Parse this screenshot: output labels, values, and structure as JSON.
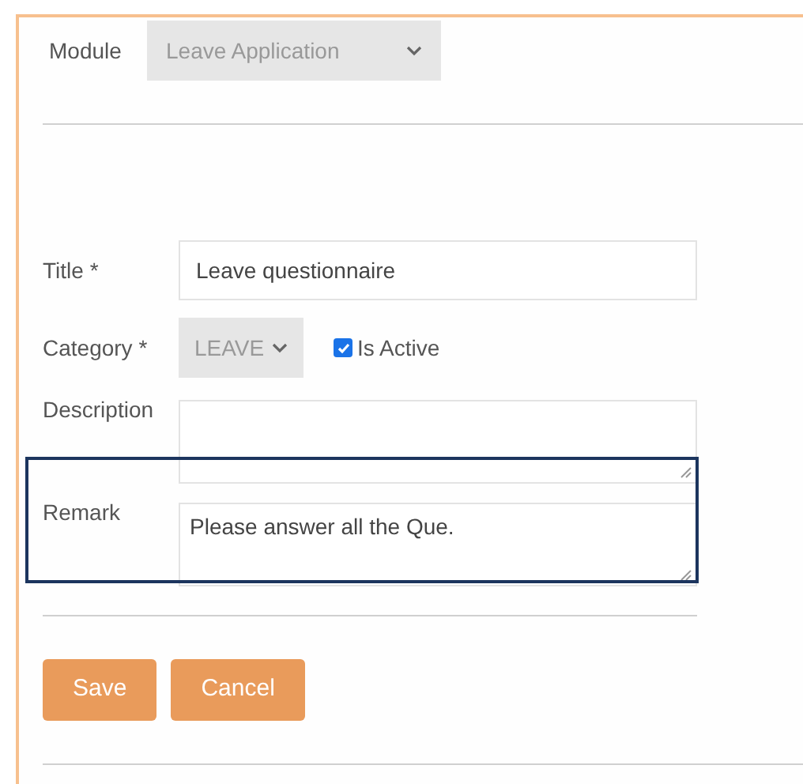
{
  "module": {
    "label": "Module",
    "value": "Leave Application",
    "disabled": true
  },
  "fields": [
    {
      "kind": "text",
      "label": "Title *",
      "value": "Leave questionnaire"
    },
    {
      "kind": "select",
      "label": "Category *",
      "value": "LEAVE",
      "disabled": true,
      "checkbox": {
        "label": "Is Active",
        "checked": true
      }
    },
    {
      "kind": "textarea",
      "label": "Description"
    },
    {
      "kind": "textarea",
      "label": "Remark",
      "value": "Please answer all the Que.",
      "highlighted": true
    }
  ],
  "buttons": [
    "Save",
    "Cancel"
  ]
}
